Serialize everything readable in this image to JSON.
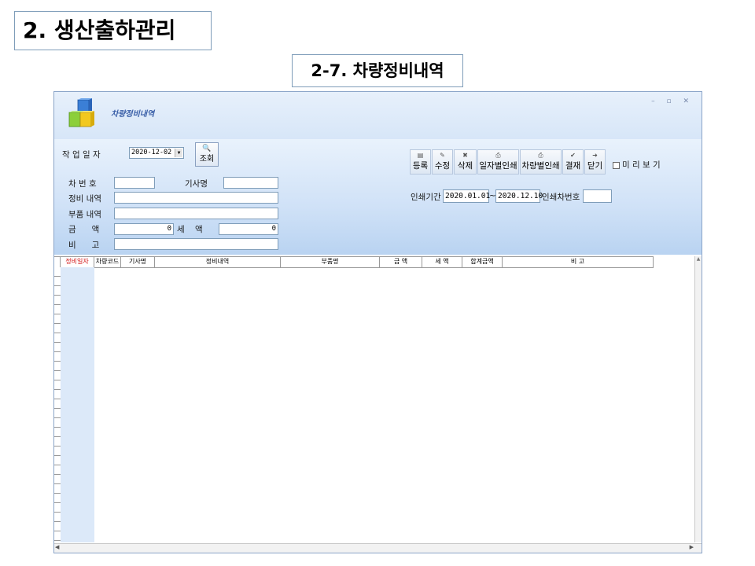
{
  "slide": {
    "title": "2. 생산출하관리",
    "subtitle": "2-7. 차량정비내역"
  },
  "window": {
    "title": "차량정비내역",
    "controls": "– ▫ ✕"
  },
  "form": {
    "work_date_label": "작 업 일 자",
    "work_date_value": "2020-12-02",
    "search_label": "조회",
    "vehicle_no_label": "차 번 호",
    "vehicle_no_value": "",
    "driver_label": "기사명",
    "driver_value": "",
    "repair_label": "정비 내역",
    "repair_value": "",
    "parts_label": "부품 내역",
    "parts_value": "",
    "amount_label": "금      액",
    "amount_value": "0",
    "tax_label": "세    액",
    "tax_value": "0",
    "note_label": "비      고",
    "note_value": ""
  },
  "toolbar": {
    "register": "등록",
    "edit": "수정",
    "delete": "삭제",
    "print_by_date": "일자별인쇄",
    "print_by_vehicle": "차량별인쇄",
    "approve": "결재",
    "close": "닫기",
    "preview": "미 리  보 기"
  },
  "print": {
    "period_label": "인쇄기간",
    "from": "2020.01.01",
    "sep": "~",
    "to": "2020.12.10",
    "vehicle_label": "인쇄차번호",
    "vehicle_value": ""
  },
  "grid": {
    "columns": [
      "정비일자",
      "차량코드",
      "기사명",
      "정비내역",
      "부품명",
      "금   액",
      "세   액",
      "합계금액",
      "비      고"
    ]
  },
  "colors": {
    "accent_red": "#d21414",
    "title_blue": "#3a5fa8",
    "form_bg": "#cfe1f7"
  }
}
